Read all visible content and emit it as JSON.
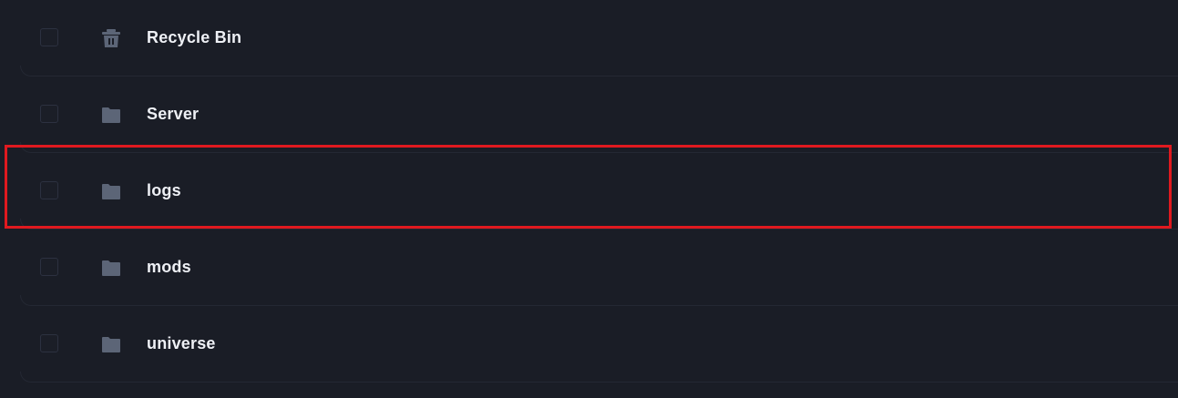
{
  "file_list": {
    "rows": [
      {
        "name": "Recycle Bin",
        "icon": "trash-icon"
      },
      {
        "name": "Server",
        "icon": "folder-icon"
      },
      {
        "name": "logs",
        "icon": "folder-icon"
      },
      {
        "name": "mods",
        "icon": "folder-icon"
      },
      {
        "name": "universe",
        "icon": "folder-icon"
      }
    ]
  },
  "colors": {
    "background": "#1a1d26",
    "text": "#eef0f5",
    "icon": "#5c6577",
    "divider": "#242833",
    "highlight": "#e0191f"
  }
}
